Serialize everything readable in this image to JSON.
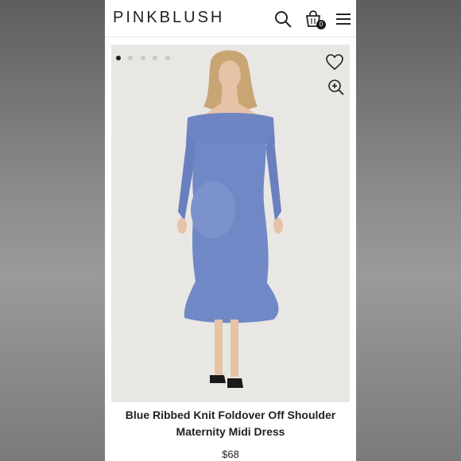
{
  "brand": {
    "name": "PINKBLUSH"
  },
  "header": {
    "icons": [
      "search-icon",
      "shopping-bag-icon",
      "menu-icon"
    ],
    "cart_count": "0"
  },
  "gallery": {
    "dots_total": 5,
    "active_index": 0,
    "icons": [
      "heart-icon",
      "zoom-icon"
    ]
  },
  "product": {
    "title_line1": "Blue Ribbed Knit Foldover Off Shoulder",
    "title_line2": "Maternity Midi Dress",
    "price": "$68",
    "dress_color": "#6f85c3"
  },
  "colors": {
    "page_background": "#ffffff",
    "image_background": "#e9e7e4"
  }
}
